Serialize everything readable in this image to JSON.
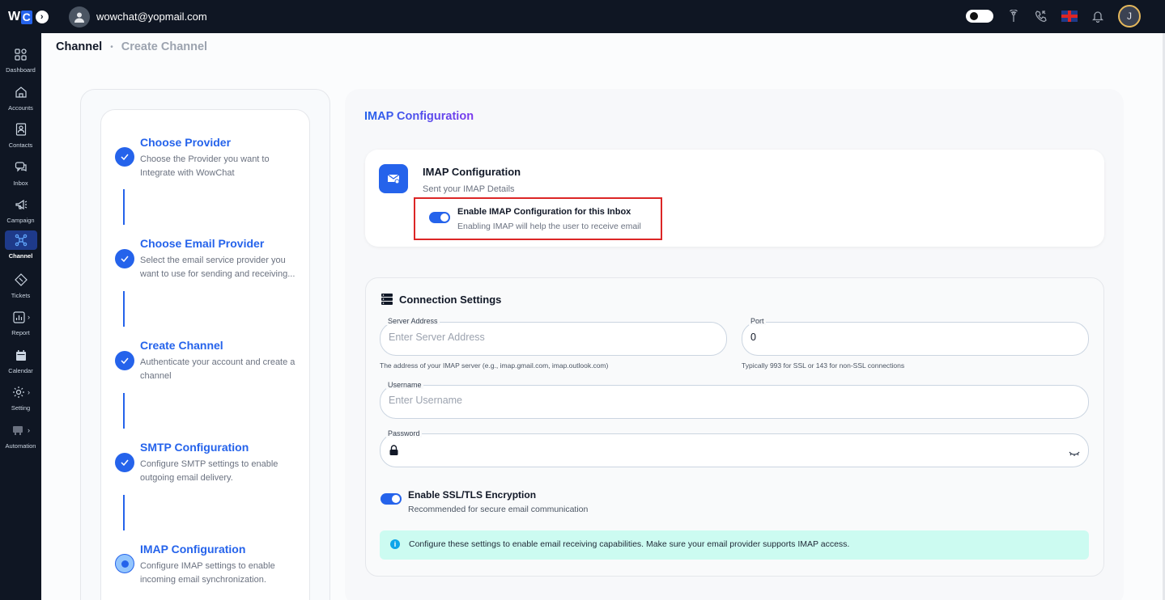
{
  "topbar": {
    "logo_w": "W",
    "logo_c": "C",
    "user_email": "wowchat@yopmail.com",
    "profile_initial": "J"
  },
  "sidebar": {
    "items": [
      {
        "label": "Dashboard",
        "icon": "dashboard-icon"
      },
      {
        "label": "Accounts",
        "icon": "home-icon"
      },
      {
        "label": "Contacts",
        "icon": "contact-card-icon"
      },
      {
        "label": "Inbox",
        "icon": "chat-icon"
      },
      {
        "label": "Campaign",
        "icon": "megaphone-icon"
      },
      {
        "label": "Channel",
        "icon": "channel-icon",
        "active": true
      },
      {
        "label": "Tickets",
        "icon": "ticket-icon"
      },
      {
        "label": "Report",
        "icon": "report-icon"
      },
      {
        "label": "Calendar",
        "icon": "calendar-icon"
      },
      {
        "label": "Setting",
        "icon": "gear-icon"
      },
      {
        "label": "Automation",
        "icon": "automation-icon"
      }
    ]
  },
  "breadcrumb": {
    "root": "Channel",
    "current": "Create Channel"
  },
  "steps": [
    {
      "title": "Choose Provider",
      "desc": "Choose the Provider you want to Integrate with WowChat",
      "status": "done"
    },
    {
      "title": "Choose Email Provider",
      "desc": "Select the email service provider you want to use for sending and receiving...",
      "status": "done"
    },
    {
      "title": "Create Channel",
      "desc": "Authenticate your account and create a channel",
      "status": "done"
    },
    {
      "title": "SMTP Configuration",
      "desc": "Configure SMTP settings to enable outgoing email delivery.",
      "status": "done"
    },
    {
      "title": "IMAP Configuration",
      "desc": "Configure IMAP settings to enable incoming email synchronization.",
      "status": "current"
    }
  ],
  "main": {
    "title": "IMAP Configuration",
    "card": {
      "title": "IMAP Configuration",
      "subtitle": "Sent your IMAP Details",
      "toggle_title": "Enable IMAP Configuration for this Inbox",
      "toggle_desc": "Enabling IMAP will help the user to receive email",
      "toggle_on": true
    },
    "connection": {
      "title": "Connection Settings",
      "server_label": "Server Address",
      "server_placeholder": "Enter Server Address",
      "server_help": "The address of your IMAP server (e.g., imap.gmail.com, imap.outlook.com)",
      "port_label": "Port",
      "port_value": "0",
      "port_help": "Typically 993 for SSL or 143 for non-SSL connections",
      "username_label": "Username",
      "username_placeholder": "Enter Username",
      "password_label": "Password",
      "ssl_title": "Enable SSL/TLS Encryption",
      "ssl_desc": "Recommended for secure email communication",
      "ssl_on": true,
      "info_text": "Configure these settings to enable email receiving capabilities. Make sure your email provider supports IMAP access."
    }
  },
  "colors": {
    "accent": "#2563eb",
    "topbar": "#0f1623",
    "highlight": "#dc2626",
    "info_bg": "#ccfbf1"
  }
}
